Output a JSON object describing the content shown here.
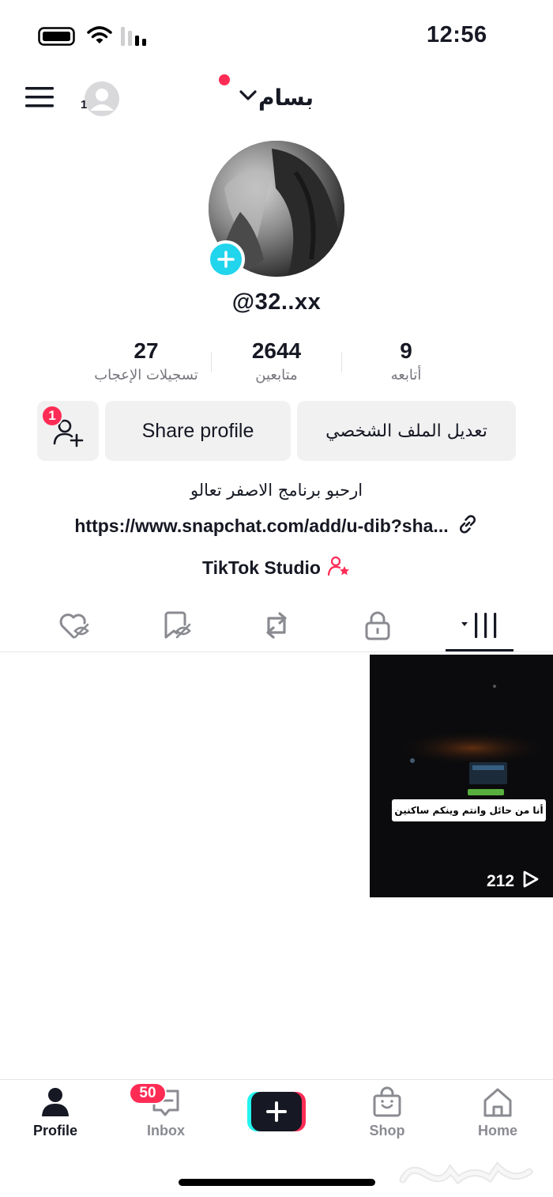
{
  "status_bar": {
    "time": "12:56"
  },
  "header": {
    "username": "بسام",
    "switch_badge": "1"
  },
  "profile": {
    "handle": "@32..xx",
    "stats": [
      {
        "value": "9",
        "label": "أتابعه"
      },
      {
        "value": "2644",
        "label": "متابعين"
      },
      {
        "value": "27",
        "label": "تسجيلات الإعجاب"
      }
    ],
    "edit_button": "تعديل الملف الشخصي",
    "share_button": "Share profile",
    "add_friend_badge": "1",
    "bio": "ارحبو برنامج الاصفر تعالو",
    "link": "https://www.snapchat.com/add/u-dib?sha...",
    "studio": "TikTok Studio"
  },
  "tabs": [
    "videos",
    "private",
    "reposts",
    "favorites",
    "liked"
  ],
  "video": {
    "caption": "أنا من حائل وانتم وينكم ساكنين",
    "views": "212"
  },
  "nav": {
    "items": [
      {
        "label": "Profile"
      },
      {
        "label": "Inbox"
      },
      {
        "label": "Shop"
      },
      {
        "label": "Home"
      }
    ],
    "inbox_badge": "50"
  },
  "colors": {
    "accent": "#fe2c55",
    "cyan": "#20d5ec",
    "text": "#161823",
    "muted": "#8a8b91"
  }
}
